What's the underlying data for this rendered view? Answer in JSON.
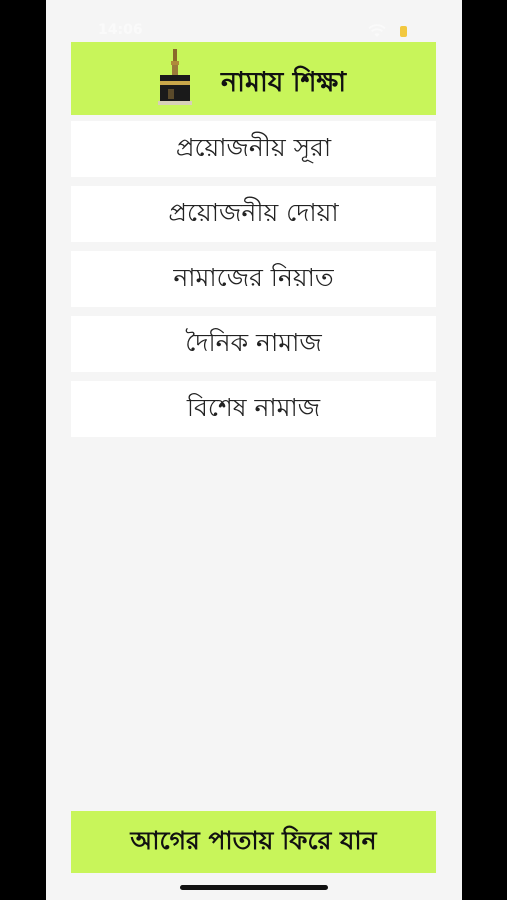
{
  "status_bar": {
    "time": "14:06"
  },
  "header": {
    "icon": "kaaba-icon",
    "title": "নামায শিক্ষা",
    "background_color": "#c8f55a"
  },
  "menu": {
    "items": [
      {
        "label": "প্রয়োজনীয় সূরা"
      },
      {
        "label": "প্রয়োজনীয় দোয়া"
      },
      {
        "label": "নামাজের নিয়াত"
      },
      {
        "label": "দৈনিক নামাজ"
      },
      {
        "label": "বিশেষ নামাজ"
      }
    ]
  },
  "footer": {
    "back_label": "আগের পাতায় ফিরে যান",
    "background_color": "#c8f55a"
  }
}
